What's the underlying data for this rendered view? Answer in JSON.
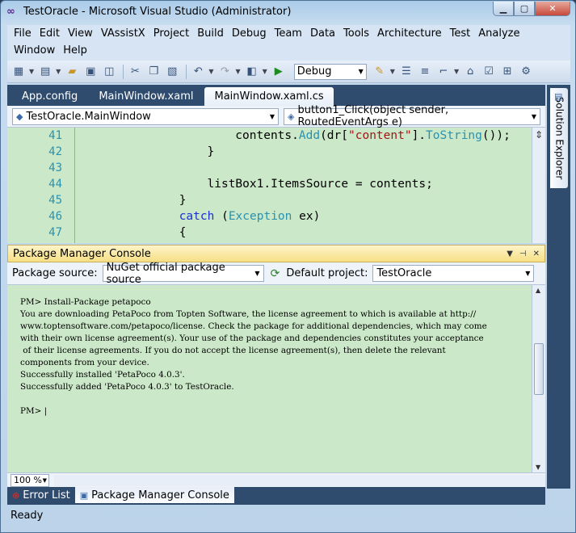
{
  "window": {
    "title": "TestOracle - Microsoft Visual Studio (Administrator)",
    "controls": {
      "minimize": "▁",
      "maximize": "▢",
      "close": "✕"
    }
  },
  "menu": {
    "row1": [
      "File",
      "Edit",
      "View",
      "VAssistX",
      "Project",
      "Build",
      "Debug",
      "Team",
      "Data",
      "Tools",
      "Architecture",
      "Test",
      "Analyze"
    ],
    "row2": [
      "Window",
      "Help"
    ]
  },
  "toolbar": {
    "configuration": "Debug"
  },
  "doc_tabs": [
    {
      "label": "App.config",
      "active": false
    },
    {
      "label": "MainWindow.xaml",
      "active": false
    },
    {
      "label": "MainWindow.xaml.cs",
      "active": true
    }
  ],
  "navigation": {
    "type": "TestOracle.MainWindow",
    "member": "button1_Click(object sender, RoutedEventArgs e)"
  },
  "editor": {
    "lines": [
      {
        "no": "41",
        "indent": 29,
        "html": "contents.<span class=\"t\">Add</span>(dr[<span class=\"s\">\"content\"</span>].<span class=\"t\">ToString</span>());"
      },
      {
        "no": "42",
        "indent": 25,
        "html": "}"
      },
      {
        "no": "43",
        "indent": 0,
        "html": ""
      },
      {
        "no": "44",
        "indent": 25,
        "html": "listBox1.ItemsSource = contents;"
      },
      {
        "no": "45",
        "indent": 21,
        "html": "}"
      },
      {
        "no": "46",
        "indent": 21,
        "html": "<span class=\"k\">catch</span> (<span class=\"t\">Exception</span> ex)"
      },
      {
        "no": "47",
        "indent": 21,
        "html": "{"
      }
    ]
  },
  "solution_explorer": {
    "label": "Solution Explorer"
  },
  "package_console": {
    "title": "Package Manager Console",
    "source_label": "Package source:",
    "source_value": "NuGet official package source",
    "project_label": "Default project:",
    "project_value": "TestOracle",
    "output": "PM> Install-Package petapoco\nYou are downloading PetaPoco from Topten Software, the license agreement to which is available at http://\nwww.toptensoftware.com/petapoco/license. Check the package for additional dependencies, which may come\nwith their own license agreement(s). Your use of the package and dependencies constitutes your acceptance\n of their license agreements. If you do not accept the license agreement(s), then delete the relevant\ncomponents from your device.\nSuccessfully installed 'PetaPoco 4.0.3'.\nSuccessfully added 'PetaPoco 4.0.3' to TestOracle.\n\nPM> |",
    "zoom": "100 %"
  },
  "bottom_tabs": [
    {
      "label": "Error List",
      "active": false
    },
    {
      "label": "Package Manager Console",
      "active": true
    }
  ],
  "status": "Ready"
}
